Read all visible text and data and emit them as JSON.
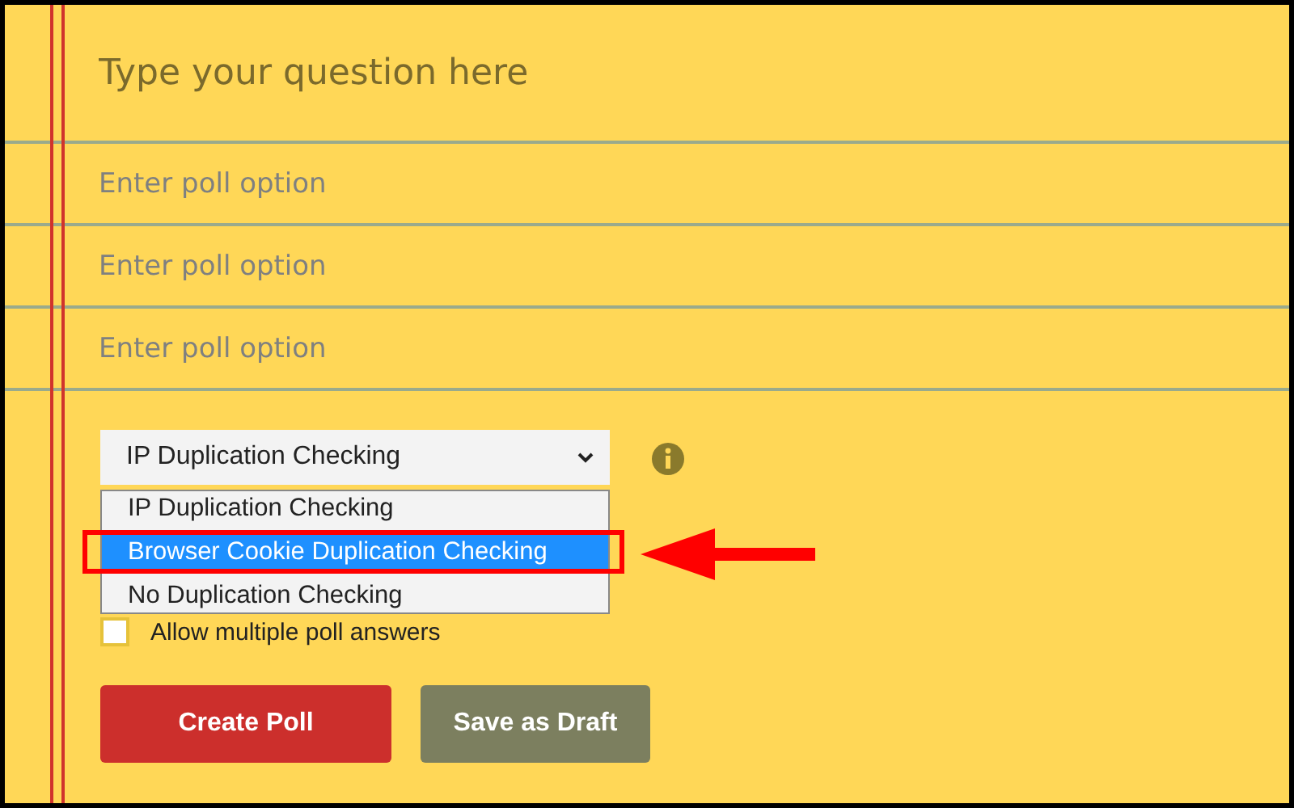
{
  "question": {
    "placeholder": "Type your question here"
  },
  "options": [
    {
      "placeholder": "Enter poll option"
    },
    {
      "placeholder": "Enter poll option"
    },
    {
      "placeholder": "Enter poll option"
    }
  ],
  "duplication": {
    "value": "IP Duplication Checking",
    "options": [
      {
        "label": "IP Duplication Checking",
        "highlighted": false
      },
      {
        "label": "Browser Cookie Duplication Checking",
        "highlighted": true
      },
      {
        "label": "No Duplication Checking",
        "highlighted": false
      }
    ]
  },
  "multiple_answers": {
    "label": "Allow multiple poll answers",
    "checked": false
  },
  "buttons": [
    {
      "label": "Create Poll",
      "kind": "primary"
    },
    {
      "label": "Save as Draft",
      "kind": "secondary"
    }
  ]
}
